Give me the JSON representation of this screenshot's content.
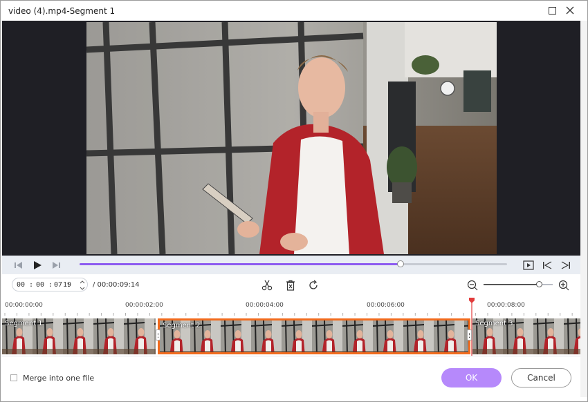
{
  "window": {
    "title": "video (4).mp4-Segment 1",
    "maximize_icon": "maximize-icon",
    "close_icon": "close-icon"
  },
  "player": {
    "progress": 0.75,
    "controls": [
      "step-back-icon",
      "play-icon",
      "step-forward-icon"
    ],
    "right_controls": [
      "preview-segment-icon",
      "jump-start-icon",
      "jump-end-icon"
    ]
  },
  "time_input": {
    "hh": "00",
    "mm": "00",
    "ss": "07",
    "ff": "19",
    "sep": ":",
    "duration": "/ 00:00:09:14"
  },
  "tools": [
    "scissors-icon",
    "delete-icon",
    "reset-icon"
  ],
  "zoom": {
    "level": 0.8,
    "out_icon": "zoom-out-icon",
    "in_icon": "zoom-in-icon"
  },
  "timeline": {
    "ruler_labels": [
      "00:00:00:00",
      "00:00:02:00",
      "00:00:04:00",
      "00:00:06:00",
      "00:00:08:00"
    ],
    "playhead_time": "00:00:07:19",
    "segments": [
      {
        "label": "Segment 1",
        "selected": false
      },
      {
        "label": "Segment 2",
        "selected": true
      },
      {
        "label": "Segment 3",
        "selected": false
      }
    ]
  },
  "footer": {
    "merge_label": "Merge into one file",
    "merge_checked": false,
    "ok_label": "OK",
    "cancel_label": "Cancel"
  },
  "colors": {
    "accent": "#8d5cf0",
    "ok_button": "#b689fb",
    "selection": "#f26b1d",
    "playhead": "#e23b3b"
  }
}
